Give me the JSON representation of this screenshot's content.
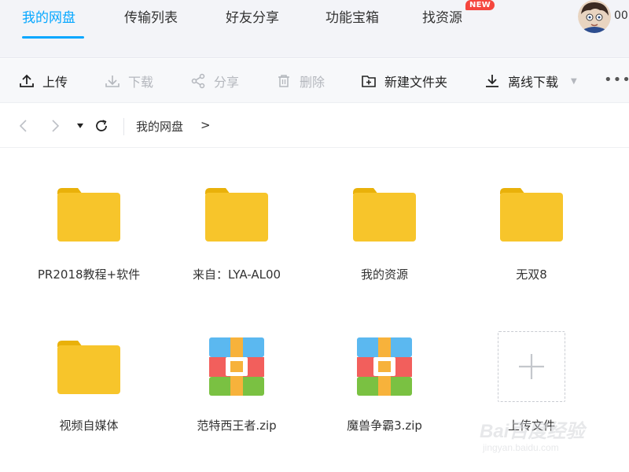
{
  "topnav": {
    "tabs": [
      {
        "label": "我的网盘",
        "active": true
      },
      {
        "label": "传输列表"
      },
      {
        "label": "好友分享"
      },
      {
        "label": "功能宝箱"
      },
      {
        "label": "找资源"
      }
    ],
    "new_badge": "NEW",
    "user_text": "00"
  },
  "toolbar": {
    "upload": "上传",
    "download": "下载",
    "share": "分享",
    "delete": "删除",
    "new_folder": "新建文件夹",
    "offline_download": "离线下载",
    "more": "•••"
  },
  "breadcrumb": {
    "path": "我的网盘",
    "arrow": ">"
  },
  "files": [
    {
      "name": "PR2018教程+软件",
      "type": "folder"
    },
    {
      "name": "来自：LYA-AL00",
      "type": "folder"
    },
    {
      "name": "我的资源",
      "type": "folder"
    },
    {
      "name": "无双8",
      "type": "folder"
    },
    {
      "name": "视频自媒体",
      "type": "folder"
    },
    {
      "name": "范特西王者.zip",
      "type": "zip"
    },
    {
      "name": "魔兽争霸3.zip",
      "type": "zip"
    },
    {
      "name": "上传文件",
      "type": "upload"
    }
  ],
  "watermark": {
    "brand": "Bai百度经验",
    "url": "jingyan.baidu.com"
  },
  "colors": {
    "accent": "#06a7ff",
    "folder": "#f7c52b",
    "folder_tab": "#e9b10a",
    "badge": "#f5463e"
  }
}
